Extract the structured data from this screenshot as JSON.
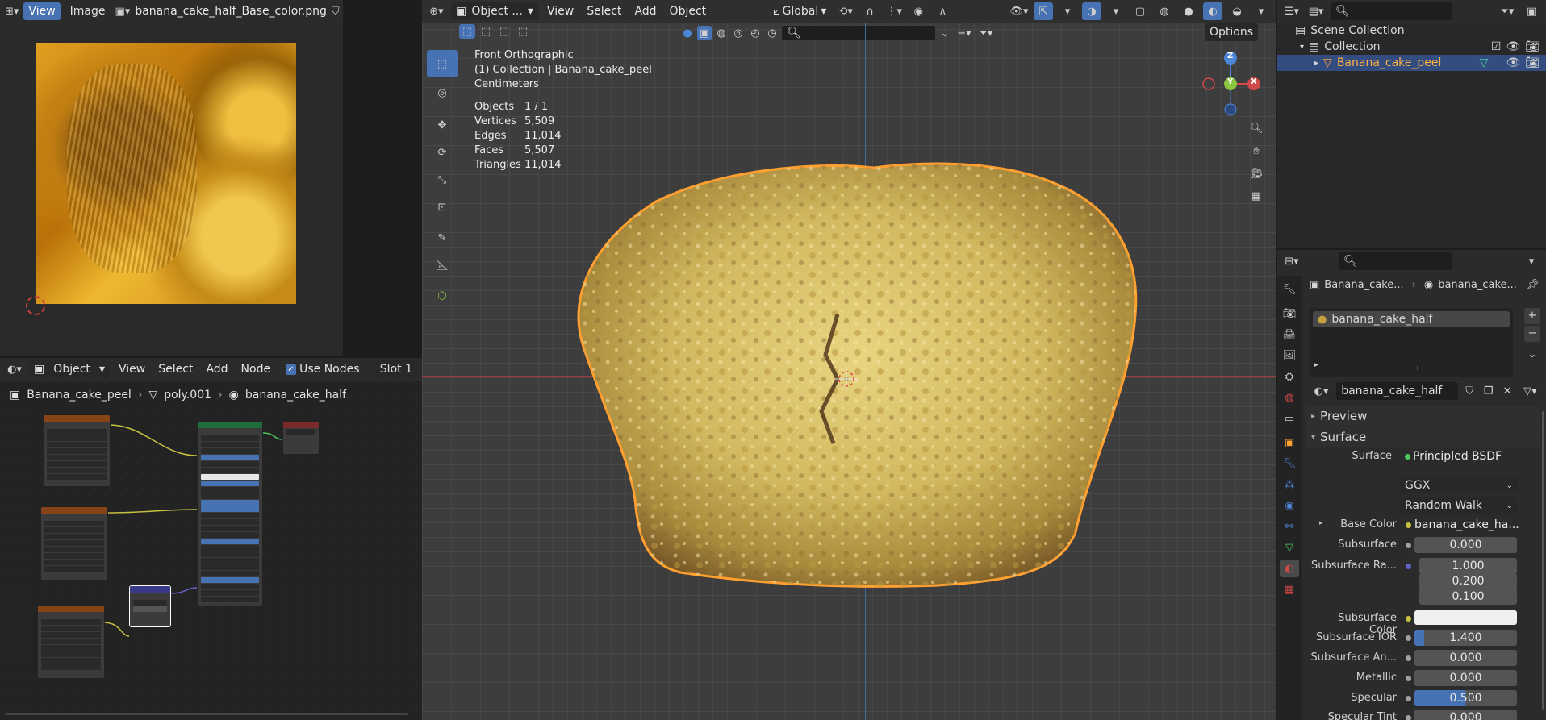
{
  "image_editor": {
    "view_menu": "View",
    "image_menu": "Image",
    "image_name": "banana_cake_half_Base_color.png"
  },
  "node_editor": {
    "object_mode": "Object",
    "menus": [
      "View",
      "Select",
      "Add",
      "Node"
    ],
    "use_nodes_label": "Use Nodes",
    "slot": "Slot 1",
    "breadcrumb": [
      "Banana_cake_peel",
      "poly.001",
      "banana_cake_half"
    ]
  },
  "viewport": {
    "mode": "Object ...",
    "menus": [
      "View",
      "Select",
      "Add",
      "Object"
    ],
    "transform": "Global",
    "options": "Options",
    "view_name": "Front Orthographic",
    "collection_line": "(1) Collection | Banana_cake_peel",
    "units": "Centimeters",
    "stats": [
      {
        "label": "Objects",
        "value": "1 / 1"
      },
      {
        "label": "Vertices",
        "value": "5,509"
      },
      {
        "label": "Edges",
        "value": "11,014"
      },
      {
        "label": "Faces",
        "value": "5,507"
      },
      {
        "label": "Triangles",
        "value": "11,014"
      }
    ],
    "gizmo": {
      "z": "Z",
      "y": "Y",
      "x": "X"
    }
  },
  "outliner": {
    "scene_collection": "Scene Collection",
    "collection": "Collection",
    "object": "Banana_cake_peel"
  },
  "properties": {
    "breadcrumb_object": "Banana_cake...",
    "breadcrumb_material": "banana_cake...",
    "material_slot": "banana_cake_half",
    "material_name": "banana_cake_half",
    "preview": "Preview",
    "surface_section": "Surface",
    "surface_label": "Surface",
    "surface_value": "Principled BSDF",
    "distribution": "GGX",
    "subsurface_method": "Random Walk",
    "rows": [
      {
        "label": "Base Color",
        "value": "banana_cake_ha...",
        "dot": "#c8c040"
      },
      {
        "label": "Subsurface",
        "value": "0.000",
        "dot": "#a0a0a0"
      },
      {
        "label": "Subsurface Ra...",
        "value": "1.000",
        "dot": "#6363c7"
      },
      {
        "label": "",
        "value": "0.200"
      },
      {
        "label": "",
        "value": "0.100"
      },
      {
        "label": "Subsurface Color",
        "value": "",
        "dot": "#c8c040"
      },
      {
        "label": "Subsurface IOR",
        "value": "1.400",
        "dot": "#a0a0a0"
      },
      {
        "label": "Subsurface An...",
        "value": "0.000",
        "dot": "#a0a0a0"
      },
      {
        "label": "Metallic",
        "value": "0.000",
        "dot": "#a0a0a0"
      },
      {
        "label": "Specular",
        "value": "0.500",
        "dot": "#a0a0a0"
      },
      {
        "label": "Specular Tint",
        "value": "0.000",
        "dot": "#a0a0a0"
      }
    ]
  },
  "colors": {
    "accent": "#4772b3",
    "selected_orange": "#ffa030",
    "x_axis": "#d04848",
    "y_axis": "#8cc63f",
    "z_axis": "#4b86d8"
  }
}
